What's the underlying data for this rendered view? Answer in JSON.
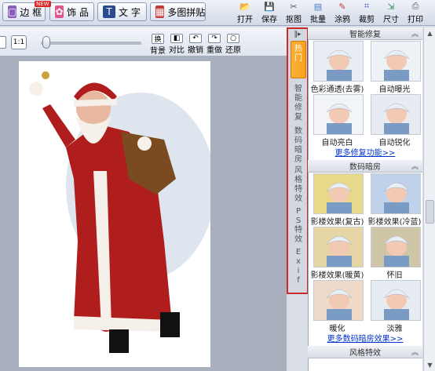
{
  "toolbar": {
    "left": [
      {
        "label": "边 框",
        "icon": "frame-icon",
        "color": "#8a5fbf"
      },
      {
        "label": "饰 品",
        "icon": "ribbon-icon",
        "color": "#e0568a"
      },
      {
        "label": "文 字",
        "icon": "text-icon",
        "color": "#2c4a8f"
      },
      {
        "label": "多图拼贴",
        "icon": "collage-icon",
        "color": "#c43a3a"
      }
    ],
    "right": [
      {
        "label": "打开",
        "icon": "open-icon"
      },
      {
        "label": "保存",
        "icon": "save-icon"
      },
      {
        "label": "抠图",
        "icon": "cutout-icon"
      },
      {
        "label": "批量",
        "icon": "batch-icon"
      },
      {
        "label": "涂鸦",
        "icon": "graffiti-icon"
      },
      {
        "label": "裁剪",
        "icon": "crop-icon"
      },
      {
        "label": "尺寸",
        "icon": "size-icon"
      },
      {
        "label": "打印",
        "icon": "print-icon"
      }
    ],
    "new_badge": "NEW"
  },
  "subtoolbar": {
    "ratio_label": "1:1",
    "buttons": [
      {
        "glyph": "换",
        "label": "背景",
        "name": "background-button"
      },
      {
        "glyph": "◧",
        "label": "对比",
        "name": "compare-button"
      },
      {
        "glyph": "↶",
        "label": "撤销",
        "name": "undo-button"
      },
      {
        "glyph": "↷",
        "label": "重做",
        "name": "redo-button"
      },
      {
        "glyph": "○",
        "label": "还原",
        "name": "restore-button"
      }
    ]
  },
  "vtabs": [
    {
      "label": "热门",
      "active": true
    },
    {
      "label": "智能修复",
      "active": false
    },
    {
      "label": "数码暗房",
      "active": false
    },
    {
      "label": "风格特效",
      "active": false
    },
    {
      "label": "PS特效",
      "active": false
    },
    {
      "label": "Exif",
      "active": false
    }
  ],
  "panel": {
    "sections": [
      {
        "title": "智能修复",
        "items": [
          {
            "label": "色彩通透(去雾)",
            "tint": "#e9eef5"
          },
          {
            "label": "自动曝光",
            "tint": "#eef1f5"
          },
          {
            "label": "自动亮白",
            "tint": "#f2f4f7"
          },
          {
            "label": "自动锐化",
            "tint": "#e8ecf2"
          }
        ],
        "more": "更多修复功能>>"
      },
      {
        "title": "数码暗房",
        "items": [
          {
            "label": "影楼效果(复古)",
            "tint": "#e8d98a"
          },
          {
            "label": "影楼效果(冷蓝)",
            "tint": "#bfd2ea"
          },
          {
            "label": "影楼效果(暖黄)",
            "tint": "#e6d6a6"
          },
          {
            "label": "怀旧",
            "tint": "#cfc6a8"
          },
          {
            "label": "暖化",
            "tint": "#efd9c8"
          },
          {
            "label": "淡雅",
            "tint": "#e7ecf2"
          }
        ],
        "more": "更多数码暗房效果>>"
      },
      {
        "title": "风格特效",
        "items": [],
        "more": ""
      }
    ]
  },
  "colors": {
    "toolbar": "#dce3ef",
    "highlight_border": "#c92b2b",
    "active_tab": "#f7a11a",
    "link": "#0033cc"
  }
}
